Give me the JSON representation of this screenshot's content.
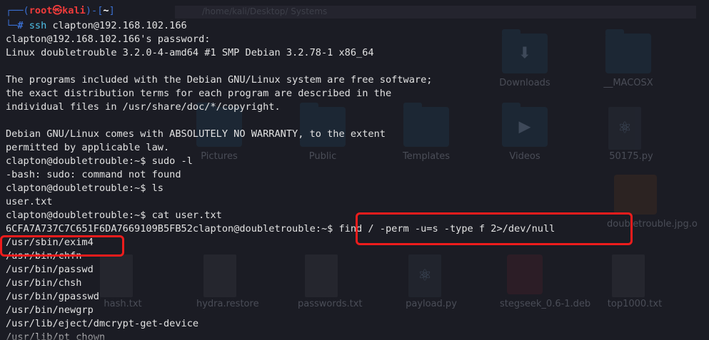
{
  "desktop": {
    "banner_text": "/home/kali/Desktop/ Systems",
    "icons": [
      {
        "name": "downloads-folder-icon",
        "label": "Downloads",
        "kind": "folder",
        "glyph": "⬇"
      },
      {
        "name": "macosx-folder-icon",
        "label": "__MACOSX",
        "kind": "folder",
        "glyph": ""
      },
      {
        "name": "pictures-folder-icon",
        "label": "Pictures",
        "kind": "folder",
        "glyph": ""
      },
      {
        "name": "public-folder-icon",
        "label": "Public",
        "kind": "folder",
        "glyph": ""
      },
      {
        "name": "templates-folder-icon",
        "label": "Templates",
        "kind": "folder",
        "glyph": ""
      },
      {
        "name": "videos-folder-icon",
        "label": "Videos",
        "kind": "folder",
        "glyph": "▶"
      },
      {
        "name": "python-file-icon",
        "label": "50175.py",
        "kind": "pyfile",
        "glyph": "⚛"
      },
      {
        "name": "hash-file-icon",
        "label": "hash.txt",
        "kind": "file",
        "glyph": ""
      },
      {
        "name": "hydra-restore-file-icon",
        "label": "hydra.restore",
        "kind": "file",
        "glyph": ""
      },
      {
        "name": "passwords-file-icon",
        "label": "passwords.txt",
        "kind": "file",
        "glyph": ""
      },
      {
        "name": "payload-python-file-icon",
        "label": "payload.py",
        "kind": "pyfile",
        "glyph": "⚛"
      },
      {
        "name": "stegseek-deb-file-icon",
        "label": "stegseek_0.6-1.deb",
        "kind": "deb",
        "glyph": ""
      },
      {
        "name": "top1000-file-icon",
        "label": "top1000.txt",
        "kind": "file",
        "glyph": ""
      },
      {
        "name": "doubletrouble-image-icon",
        "label": "doubletrouble.jpg.o",
        "kind": "img",
        "glyph": ""
      }
    ]
  },
  "prompt": {
    "frame_top": "┌──(",
    "user": "root",
    "at": "㉿",
    "host": "kali",
    "frame_mid": ")-[",
    "cwd": "~",
    "frame_end": "]",
    "frame_bottom": "└─",
    "hash": "#",
    "command": "ssh",
    "args": "clapton@192.168.102.166"
  },
  "terminal": {
    "lines": [
      "clapton@192.168.102.166's password: ",
      "Linux doubletrouble 3.2.0-4-amd64 #1 SMP Debian 3.2.78-1 x86_64",
      "",
      "The programs included with the Debian GNU/Linux system are free software;",
      "the exact distribution terms for each program are described in the",
      "individual files in /usr/share/doc/*/copyright.",
      "",
      "Debian GNU/Linux comes with ABSOLUTELY NO WARRANTY, to the extent",
      "permitted by applicable law.",
      "clapton@doubletrouble:~$ sudo -l",
      "-bash: sudo: command not found",
      "clapton@doubletrouble:~$ ls",
      "user.txt",
      "clapton@doubletrouble:~$ cat user.txt",
      "6CFA7A737C7C651F6DA7669109B5FB52clapton@doubletrouble:~$ find / -perm -u=s -type f 2>/dev/null",
      "/usr/sbin/exim4",
      "/usr/bin/chfn",
      "/usr/bin/passwd",
      "/usr/bin/chsh",
      "/usr/bin/gpasswd",
      "/usr/bin/newgrp",
      "/usr/lib/eject/dmcrypt-get-device",
      "/usr/lib/pt_chown"
    ]
  },
  "highlights": {
    "color": "#ee1c1c",
    "find_command_label": "find command highlight",
    "exim4_label": "exim4 highlight"
  }
}
